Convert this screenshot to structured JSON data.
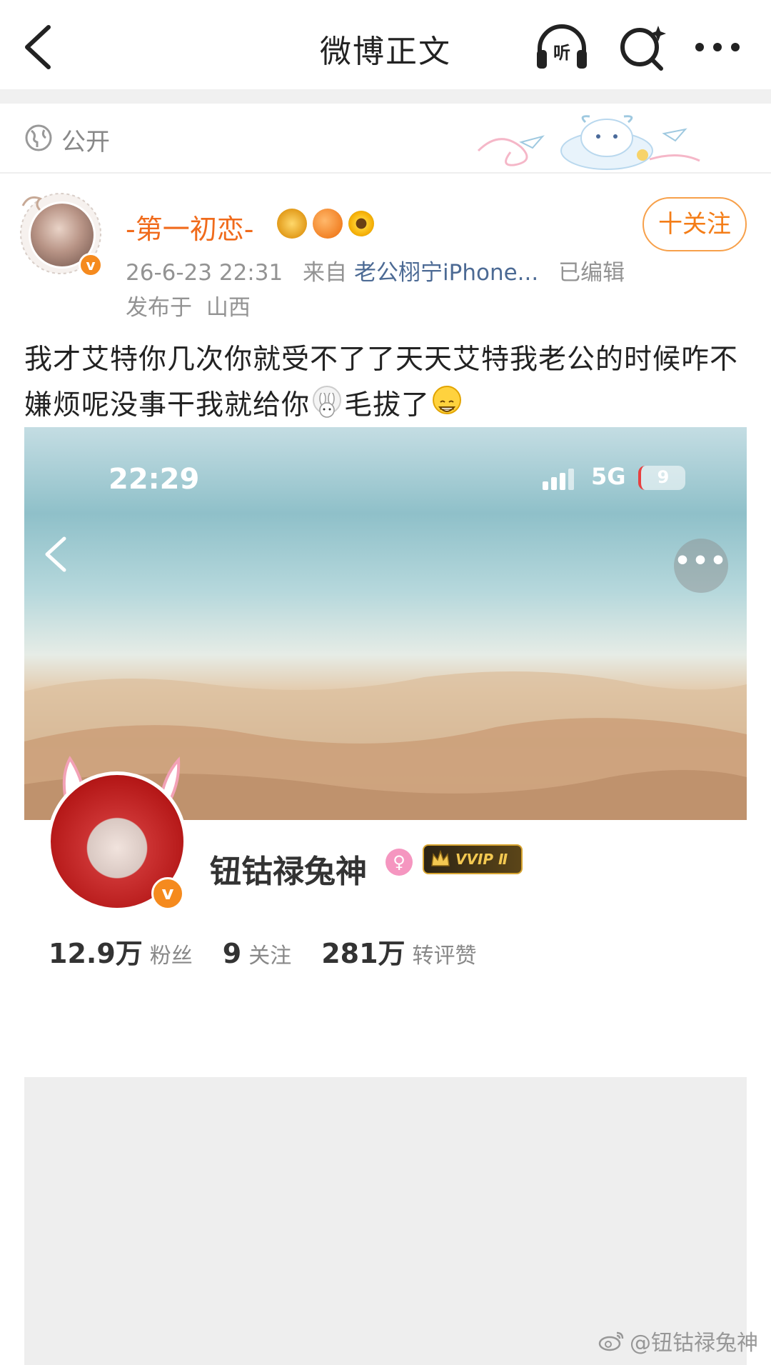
{
  "nav": {
    "title": "微博正文",
    "listen_label": "听"
  },
  "visibility": {
    "label": "公开"
  },
  "post": {
    "author": "-第一初恋-",
    "follow_label": "十关注",
    "timestamp": "26-6-23 22:31",
    "source_prefix": "来自",
    "source": "老公栩宁iPhone...",
    "edited": "已编辑",
    "location_prefix": "发布于",
    "location": "山西",
    "text_part1": "我才艾特你几次你就受不了了天天艾特我老公的时候咋不嫌烦呢没事干我就给你",
    "text_part2": "毛拔了",
    "emoji_1": "rabbit-emoji",
    "emoji_2": "grin-emoji"
  },
  "embed": {
    "status_time": "22:29",
    "network": "5G",
    "battery": "9",
    "profile_name": "钮钴禄兔神",
    "vip_label": "VVIP Ⅱ",
    "stats": [
      {
        "value": "12.9万",
        "label": "粉丝"
      },
      {
        "value": "9",
        "label": "关注"
      },
      {
        "value": "281万",
        "label": "转评赞"
      }
    ]
  },
  "watermark": "@钮钴禄兔神",
  "colors": {
    "accent_orange": "#f06b1c",
    "link_blue": "#4c6a94",
    "meta_gray": "#939393"
  }
}
